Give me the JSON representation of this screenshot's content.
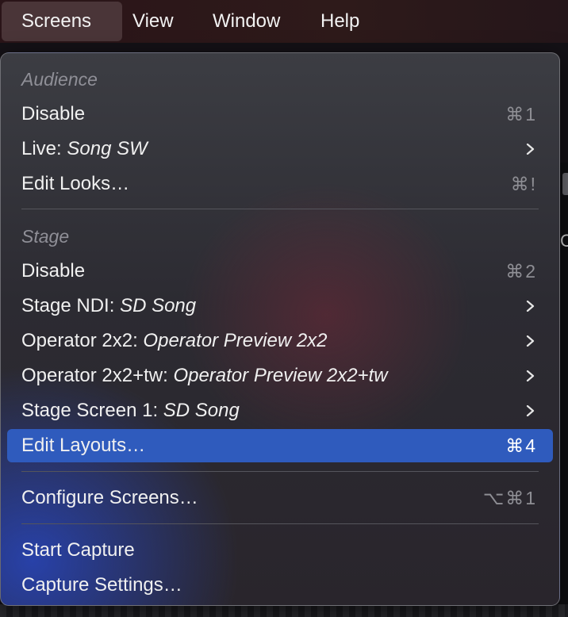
{
  "menubar": {
    "items": [
      {
        "label": "Screens",
        "active": true
      },
      {
        "label": "View"
      },
      {
        "label": "Window"
      },
      {
        "label": "Help"
      }
    ]
  },
  "menu": {
    "audience_header": "Audience",
    "audience_disable": {
      "label": "Disable",
      "shortcut": "⌘1"
    },
    "audience_live": {
      "prefix": "Live: ",
      "value": "Song SW"
    },
    "audience_edit_looks": {
      "label": "Edit Looks…",
      "shortcut": "⌘!"
    },
    "stage_header": "Stage",
    "stage_disable": {
      "label": "Disable",
      "shortcut": "⌘2"
    },
    "stage_ndi": {
      "prefix": "Stage NDI: ",
      "value": "SD Song"
    },
    "operator_2x2": {
      "prefix": "Operator 2x2: ",
      "value": "Operator Preview 2x2"
    },
    "operator_2x2tw": {
      "prefix": "Operator 2x2+tw: ",
      "value": "Operator Preview 2x2+tw"
    },
    "stage_screen_1": {
      "prefix": "Stage Screen 1: ",
      "value": "SD Song"
    },
    "edit_layouts": {
      "label": "Edit Layouts…",
      "shortcut": "⌘4"
    },
    "configure_screens": {
      "label": "Configure Screens…",
      "shortcut": "⌥⌘1"
    },
    "start_capture": {
      "label": "Start Capture"
    },
    "capture_settings": {
      "label": "Capture Settings…"
    }
  },
  "background": {
    "right_panel_text": "C"
  },
  "colors": {
    "highlight": "#2f5bbd",
    "menubar": "#2a1418",
    "menu_text": "#f0f0f0",
    "secondary_text": "#8e8e94"
  }
}
